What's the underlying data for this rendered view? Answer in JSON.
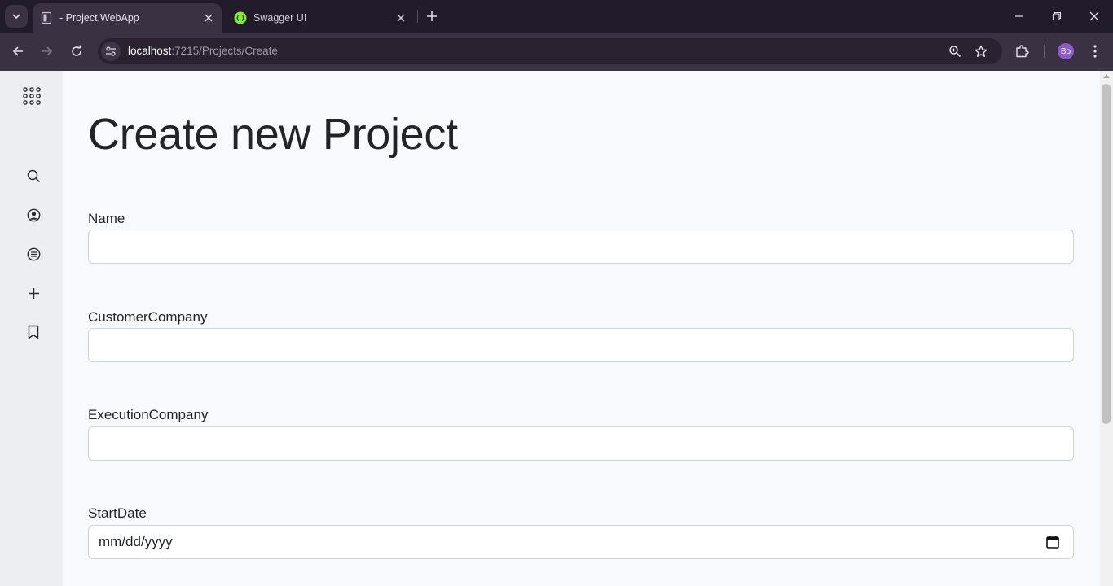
{
  "browser": {
    "tabs": [
      {
        "title": "- Project.WebApp",
        "active": true,
        "favicon": "document-icon"
      },
      {
        "title": "Swagger UI",
        "active": false,
        "favicon": "swagger-icon"
      }
    ],
    "url": {
      "host": "localhost",
      "path": ":7215/Projects/Create"
    },
    "profile_initials": "Bo",
    "accent": "#8b5cc6"
  },
  "sidebar": {
    "items": [
      {
        "icon": "apps-grid-icon"
      },
      {
        "icon": "search-icon"
      },
      {
        "icon": "account-icon"
      },
      {
        "icon": "list-icon"
      },
      {
        "icon": "plus-icon"
      },
      {
        "icon": "bookmark-icon"
      }
    ]
  },
  "page": {
    "title": "Create new Project",
    "fields": [
      {
        "label": "Name",
        "value": ""
      },
      {
        "label": "CustomerCompany",
        "value": ""
      },
      {
        "label": "ExecutionCompany",
        "value": ""
      },
      {
        "label": "StartDate",
        "placeholder": "mm/dd/yyyy"
      }
    ]
  }
}
